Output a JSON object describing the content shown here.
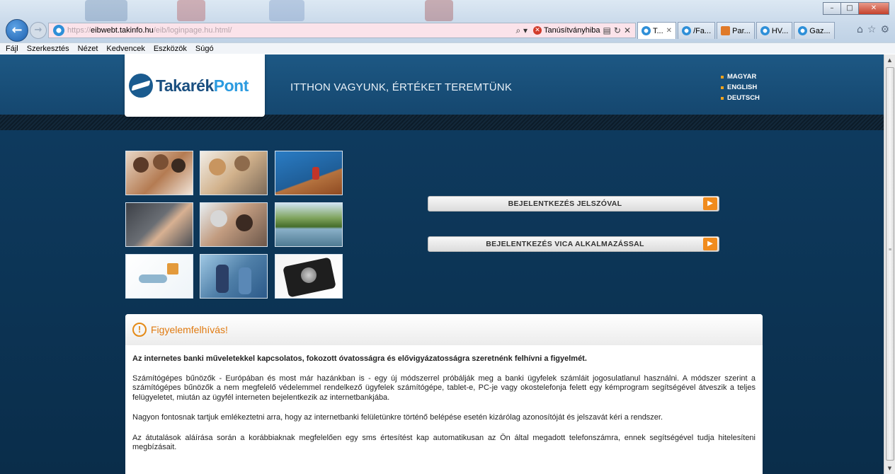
{
  "browser": {
    "window_buttons": [
      "–",
      "□",
      "✕"
    ],
    "url": {
      "scheme": "https://",
      "host": "eibwebt.takinfo.hu",
      "path": "/eib/loginpage.hu.html/"
    },
    "search_glyph": "⌕ ▾",
    "cert_error": "Tanúsítványhiba",
    "tabs": [
      {
        "label": "T...",
        "active": true,
        "icon": "ie-icon"
      },
      {
        "label": "/Fa...",
        "active": false,
        "icon": "ie-icon"
      },
      {
        "label": "Par...",
        "active": false,
        "icon": "partner-icon"
      },
      {
        "label": "HV...",
        "active": false,
        "icon": "ie-icon"
      },
      {
        "label": "Gaz...",
        "active": false,
        "icon": "ie-icon"
      }
    ],
    "menu": [
      "Fájl",
      "Szerkesztés",
      "Nézet",
      "Kedvencek",
      "Eszközök",
      "Súgó"
    ]
  },
  "site": {
    "logo": {
      "part1": "Takarék",
      "part2": "Pont"
    },
    "slogan": "ITTHON VAGYUNK, ÉRTÉKET TEREMTÜNK",
    "languages": [
      "MAGYAR",
      "ENGLISH",
      "DEUTSCH"
    ],
    "login_buttons": {
      "password": "BEJELENTKEZÉS JELSZÓVAL",
      "vica": "BEJELENTKEZÉS VICA ALKALMAZÁSSAL"
    },
    "notice": {
      "title": "Figyelemfelhívás!",
      "lead": "Az internetes banki műveletekkel kapcsolatos, fokozott óvatosságra és elővigyázatosságra szeretnénk felhívni a figyelmét.",
      "p1": "Számítógépes bűnözők - Európában és most már hazánkban is - egy új módszerrel próbálják meg a banki ügyfelek számláit jogosulatlanul használni. A módszer szerint a számítógépes bűnözők a nem megfelelő védelemmel rendelkező ügyfelek számítógépe, tablet-e, PC-je vagy okostelefonja felett egy kémprogram segítségével átveszik a teljes felügyeletet, miután az ügyfél interneten bejelentkezik az internetbankjába.",
      "p2": "Nagyon fontosnak tartjuk emlékeztetni arra, hogy az internetbanki felületünkre történő belépése esetén kizárólag azonosítóját és jelszavát kéri a rendszer.",
      "p3": "Az átutalások aláírása során a korábbiaknak megfelelően egy sms értesítést kap automatikusan az Ön által megadott telefonszámra, ennek segítségével tudja hitelesíteni megbízásait."
    }
  },
  "colors": {
    "accent_orange": "#f08b1d",
    "header_blue": "#1a527d",
    "brand_dark_blue": "#1a4f80",
    "brand_light_blue": "#2b9be0"
  }
}
